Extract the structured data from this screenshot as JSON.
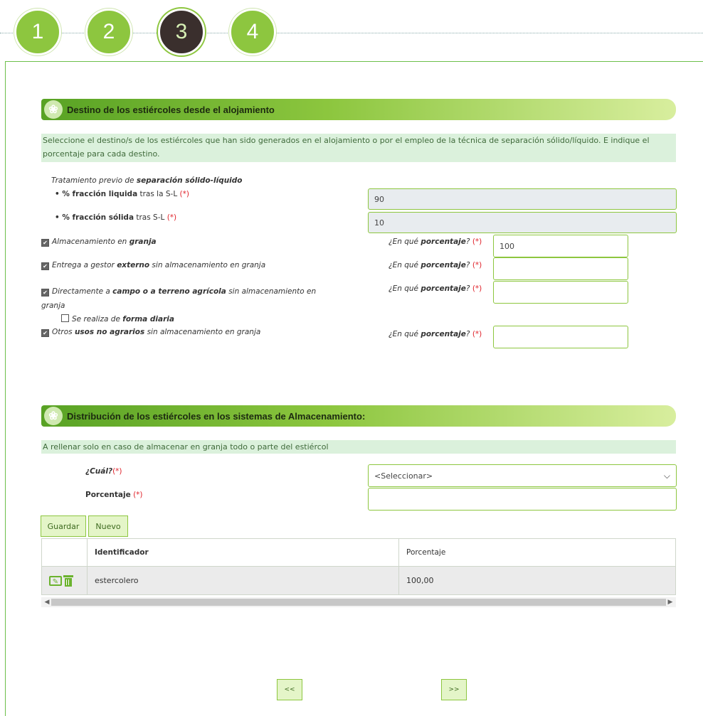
{
  "stepper": [
    "1",
    "2",
    "3",
    "4"
  ],
  "section1": {
    "title": "Destino de los estiércoles desde el alojamiento",
    "info": "Seleccione el destino/s de los estiércoles que han sido generados en el alojamiento o por el empleo de la técnica de separación sólido/líquido. E indique el porcentaje para cada destino.",
    "tratamiento_pre": "Tratamiento previo de ",
    "tratamiento_bold": "separación sólido-líquido",
    "liquida_bold": "• % fracción liquida",
    "liquida_rest": " tras la S-L ",
    "liquida_value": "90",
    "solida_bold": "• % fracción sólida",
    "solida_rest": " tras S-L ",
    "solida_value": "10",
    "required": "(*)",
    "question_pre": "¿En qué ",
    "question_bold": "porcentaje",
    "question_post": "? ",
    "opt1_pre": "Almacenamiento en ",
    "opt1_bold": "granja",
    "opt1_value": "100",
    "opt2_pre": "Entrega a gestor ",
    "opt2_bold": "externo",
    "opt2_post": " sin almacenamiento en granja",
    "opt3_pre": "Directamente a ",
    "opt3_bold": "campo o a terreno agrícola",
    "opt3_post": " sin almacenamiento en",
    "opt3_line2": "granja",
    "opt3_sub_pre": "Se realiza de ",
    "opt3_sub_bold": "forma diaria",
    "opt4_pre": "Otros ",
    "opt4_bold": "usos no agrarios",
    "opt4_post": " sin almacenamiento en granja"
  },
  "section2": {
    "title": "Distribución de los estiércoles en los sistemas de Almacenamiento:",
    "info": "A rellenar solo en caso de almacenar en granja todo o parte del estiércol",
    "cual_label": "¿Cuál?",
    "select_value": "<Seleccionar>",
    "porcentaje_label": "Porcentaje",
    "guardar": "Guardar",
    "nuevo": "Nuevo",
    "table": {
      "headers": [
        "Identificador",
        "Porcentaje"
      ],
      "rows": [
        {
          "id": "estercolero",
          "pct": "100,00"
        }
      ]
    }
  },
  "nav": {
    "prev": "<<",
    "next": ">>"
  },
  "colors": {
    "accent": "#8dc63f",
    "active_step": "#3a2f2d",
    "required": "#e0232b",
    "info_bg": "#dbf1dc"
  }
}
